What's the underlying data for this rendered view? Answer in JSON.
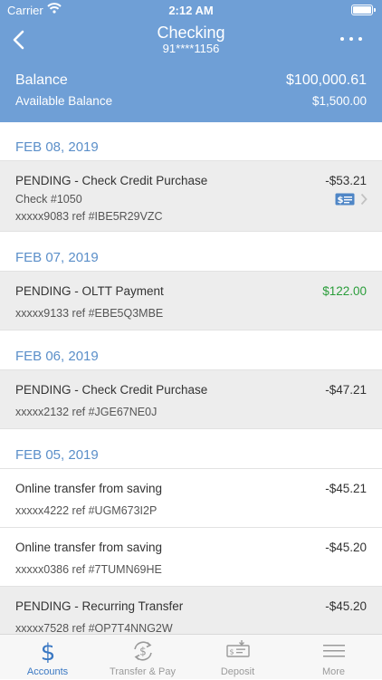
{
  "status_bar": {
    "carrier": "Carrier",
    "time": "2:12 AM"
  },
  "header": {
    "title": "Checking",
    "account_number": "91****1156",
    "balance_label": "Balance",
    "balance_value": "$100,000.61",
    "available_label": "Available Balance",
    "available_value": "$1,500.00"
  },
  "groups": [
    {
      "date": "FEB 08, 2019",
      "items": [
        {
          "description": "PENDING - Check Credit Purchase",
          "sub": "Check #1050",
          "ref": "xxxxx9083 ref #IBE5R29VZC",
          "amount": "-$53.21",
          "pending": true,
          "positive": false,
          "has_check_image": true
        }
      ]
    },
    {
      "date": "FEB 07, 2019",
      "items": [
        {
          "description": "PENDING - OLTT Payment",
          "ref": "xxxxx9133 ref #EBE5Q3MBE",
          "amount": "$122.00",
          "pending": true,
          "positive": true
        }
      ]
    },
    {
      "date": "FEB 06, 2019",
      "items": [
        {
          "description": "PENDING - Check Credit Purchase",
          "ref": "xxxxx2132 ref #JGE67NE0J",
          "amount": "-$47.21",
          "pending": true,
          "positive": false
        }
      ]
    },
    {
      "date": "FEB 05, 2019",
      "items": [
        {
          "description": "Online transfer from saving",
          "ref": "xxxxx4222 ref #UGM673I2P",
          "amount": "-$45.21",
          "pending": false,
          "positive": false
        },
        {
          "description": "Online transfer from saving",
          "ref": "xxxxx0386 ref #7TUMN69HE",
          "amount": "-$45.20",
          "pending": false,
          "positive": false
        },
        {
          "description": "PENDING - Recurring Transfer",
          "ref": "xxxxx7528 ref #OP7T4NNG2W",
          "amount": "-$45.20",
          "pending": true,
          "positive": false
        }
      ]
    }
  ],
  "tabs": [
    {
      "label": "Accounts",
      "icon": "dollar-icon",
      "active": true
    },
    {
      "label": "Transfer & Pay",
      "icon": "transfer-pay-icon",
      "active": false
    },
    {
      "label": "Deposit",
      "icon": "deposit-check-icon",
      "active": false
    },
    {
      "label": "More",
      "icon": "menu-icon",
      "active": false
    }
  ],
  "colors": {
    "header": "#6f9fd6",
    "date_text": "#5b8fc9",
    "positive_amount": "#2a9d3a",
    "pending_row": "#ededed",
    "active_tab": "#3a78c3",
    "inactive_tab": "#9a9a9a"
  }
}
